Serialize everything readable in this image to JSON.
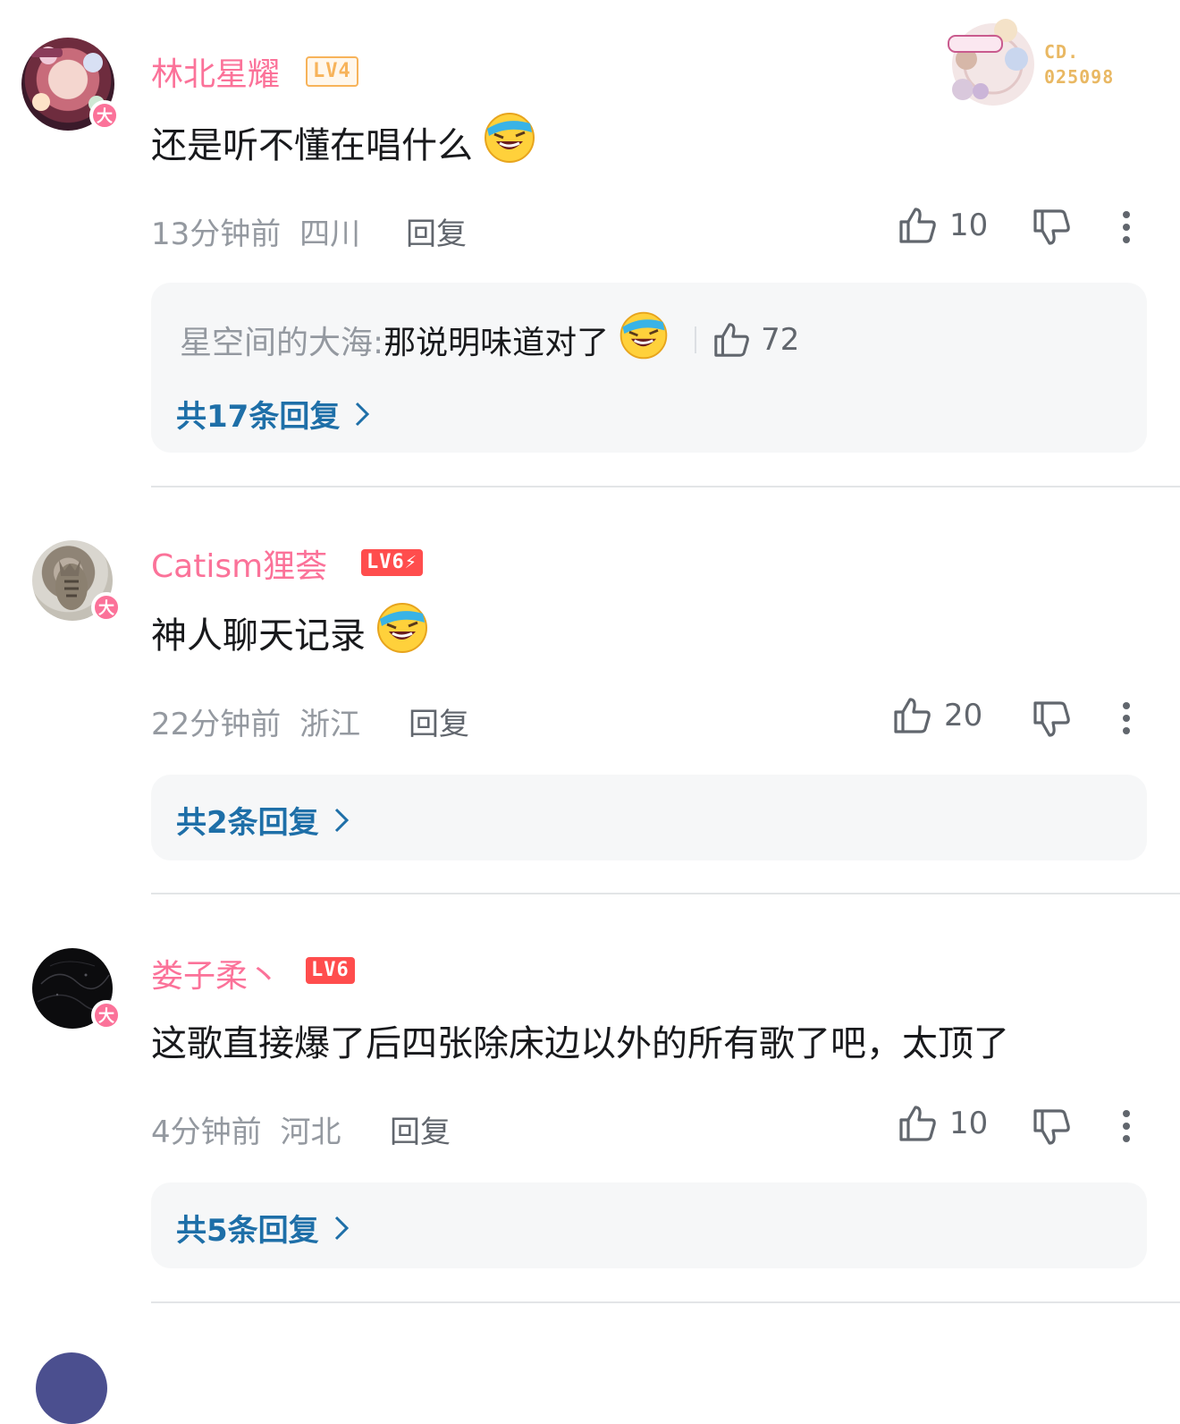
{
  "comments": [
    {
      "username": "林北星耀",
      "level": "LV4",
      "avatar_badge": "大",
      "message": "还是听不懂在唱什么",
      "emoji": "laughing-crying-emoji",
      "time": "13分钟前",
      "location": "四川",
      "reply_label": "回复",
      "likes": "10",
      "fan_badge": {
        "label": "CD.",
        "number": "025098"
      },
      "sub_reply": {
        "user": "星空间的大海:",
        "text": "那说明味道对了",
        "likes": "72"
      },
      "more_replies": "共17条回复"
    },
    {
      "username": "Catism狸荟",
      "level": "LV6",
      "avatar_badge": "大",
      "message": "神人聊天记录",
      "emoji": "laughing-crying-emoji",
      "time": "22分钟前",
      "location": "浙江",
      "reply_label": "回复",
      "likes": "20",
      "more_replies": "共2条回复"
    },
    {
      "username": "娄子柔丶",
      "level": "LV6",
      "avatar_badge": "大",
      "message": "这歌直接爆了后四张除床边以外的所有歌了吧，太顶了",
      "time": "4分钟前",
      "location": "河北",
      "reply_label": "回复",
      "likes": "10",
      "more_replies": "共5条回复"
    }
  ],
  "colors": {
    "username": "#fb7299",
    "meta": "#9499a0",
    "link": "#1e6fa8",
    "level6": "#ff4d4d",
    "level4": "#f7b35a",
    "box": "#f6f7f8"
  }
}
